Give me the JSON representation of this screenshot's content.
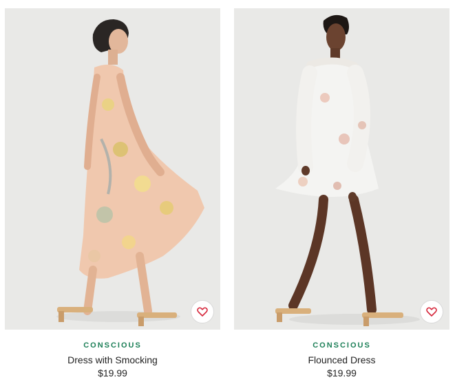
{
  "products": [
    {
      "tag": "CONSCIOUS",
      "name": "Dress with Smocking",
      "price": "$19.99",
      "favorite_icon": "heart-outline-icon"
    },
    {
      "tag": "CONSCIOUS",
      "name": "Flounced Dress",
      "price": "$19.99",
      "favorite_icon": "heart-outline-icon"
    }
  ],
  "colors": {
    "tag": "#1c7f57",
    "heart": "#d6283c",
    "photo_bg": "#e9e9e7"
  }
}
